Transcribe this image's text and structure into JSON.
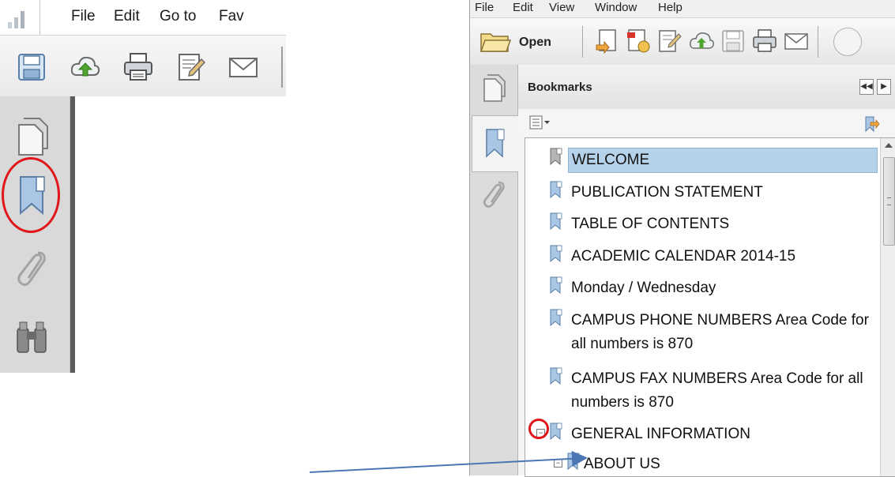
{
  "left_panel": {
    "menu": [
      "File",
      "Edit",
      "Go to",
      "Fav"
    ],
    "toolbar_icons": [
      "save-icon",
      "cloud-upload-icon",
      "print-icon",
      "edit-icon",
      "mail-icon"
    ],
    "sidebar_icons": [
      "pages-icon",
      "bookmarks-icon",
      "attachments-icon",
      "search-binoculars-icon"
    ]
  },
  "right_panel": {
    "menu": [
      "File",
      "Edit",
      "View",
      "Window",
      "Help"
    ],
    "toolbar": {
      "open_label": "Open",
      "icons": [
        "create-icon",
        "export-icon",
        "edit-icon",
        "cloud-upload-icon",
        "save-icon",
        "print-icon",
        "mail-icon"
      ]
    },
    "nav_icons": [
      "pages-icon",
      "bookmarks-icon",
      "attachments-icon"
    ],
    "bookmarks": {
      "title": "Bookmarks",
      "header_buttons": [
        "◀◀",
        "▶"
      ],
      "items": [
        {
          "label": "WELCOME",
          "selected": true
        },
        {
          "label": "PUBLICATION STATEMENT"
        },
        {
          "label": "TABLE OF CONTENTS"
        },
        {
          "label": "ACADEMIC CALENDAR 2014-15"
        },
        {
          "label": "Monday / Wednesday"
        },
        {
          "label": "CAMPUS PHONE NUMBERS   Area Code for all numbers is 870"
        },
        {
          "label": "CAMPUS FAX NUMBERS   Area Code for all numbers is 870"
        },
        {
          "label": "GENERAL INFORMATION",
          "collapsible": true
        },
        {
          "label": "ABOUT US",
          "collapsible": true
        }
      ]
    }
  },
  "colors": {
    "annotation_red": "#e0161b",
    "selection_blue": "#b6d2ea",
    "arrow_blue": "#4a77b4"
  }
}
